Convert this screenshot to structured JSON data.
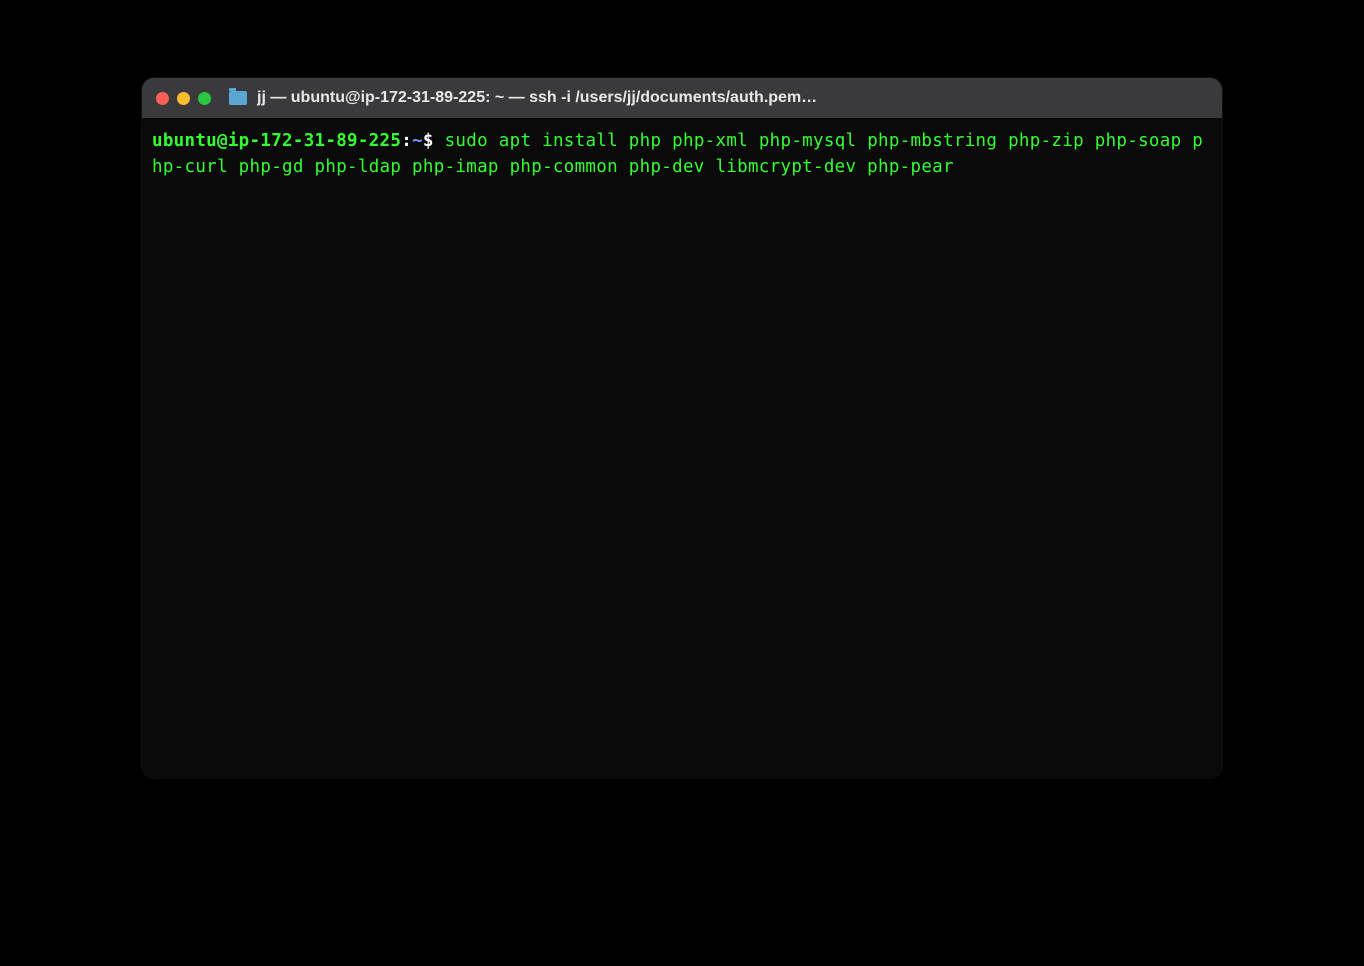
{
  "window": {
    "title": "jj — ubuntu@ip-172-31-89-225: ~ — ssh -i /users/jj/documents/auth.pem…"
  },
  "terminal": {
    "prompt": {
      "user_host": "ubuntu@ip-172-31-89-225",
      "separator": ":",
      "path": "~",
      "symbol": "$"
    },
    "command": " sudo apt install php php-xml php-mysql php-mbstring php-zip php-soap php-curl php-gd php-ldap php-imap php-common php-dev libmcrypt-dev php-pear"
  }
}
